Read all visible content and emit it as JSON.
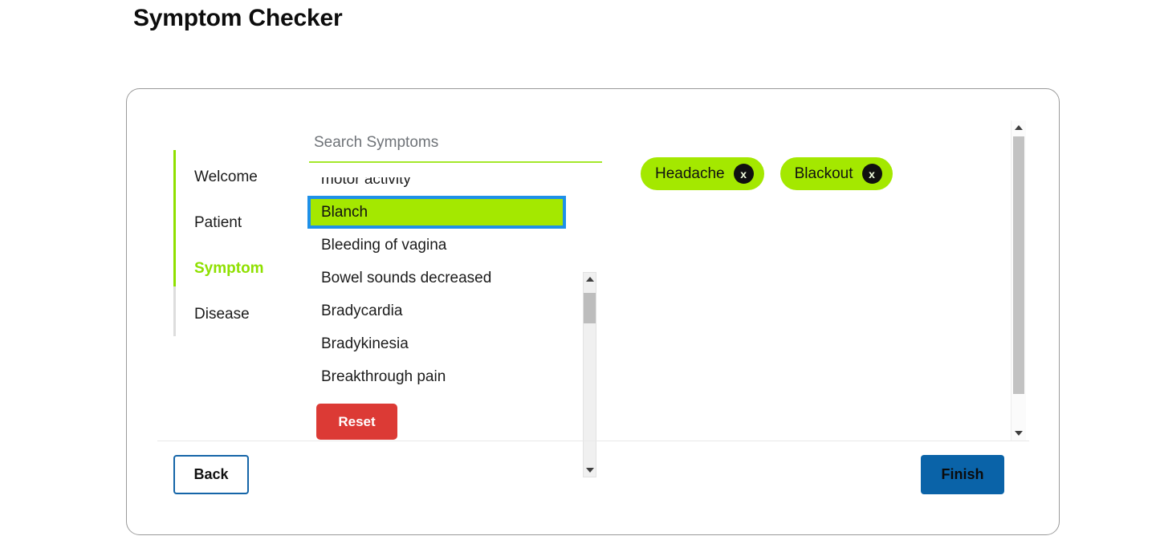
{
  "page": {
    "title": "Symptom Checker"
  },
  "stepper": {
    "steps": [
      {
        "label": "Welcome",
        "active": false
      },
      {
        "label": "Patient",
        "active": false
      },
      {
        "label": "Symptom",
        "active": true
      },
      {
        "label": "Disease",
        "active": false
      }
    ],
    "rail_color": "#8fe000",
    "rail_inactive_color": "#dddddd"
  },
  "search": {
    "placeholder": "Search Symptoms",
    "value": "",
    "underline_color": "#a4e82b"
  },
  "symptom_list": {
    "items": [
      {
        "label": "motor activity",
        "selected": false
      },
      {
        "label": "Blanch",
        "selected": true
      },
      {
        "label": "Bleeding of vagina",
        "selected": false
      },
      {
        "label": "Bowel sounds decreased",
        "selected": false
      },
      {
        "label": "Bradycardia",
        "selected": false
      },
      {
        "label": "Bradykinesia",
        "selected": false
      },
      {
        "label": "Breakthrough pain",
        "selected": false
      }
    ],
    "selected_bg": "#a4e800",
    "focus_outline": "#1e90e8",
    "scrollbar": {
      "up_arrow": "triangle-up-icon",
      "down_arrow": "triangle-down-icon",
      "thumb_color": "#bdbdbd",
      "track_color": "#f0f0f0"
    }
  },
  "selected_tags": {
    "items": [
      {
        "label": "Headache",
        "remove_label": "x"
      },
      {
        "label": "Blackout",
        "remove_label": "x"
      }
    ],
    "bg_color": "#a4e800",
    "remove_bg_color": "#101010"
  },
  "panel_scrollbar": {
    "up_arrow": "triangle-up-icon",
    "down_arrow": "triangle-down-icon",
    "thumb_color": "#c2c2c2",
    "track_color": "#fbfbfb"
  },
  "buttons": {
    "reset": {
      "label": "Reset",
      "bg": "#dc3a35",
      "fg": "#ffffff"
    },
    "back": {
      "label": "Back",
      "border": "#1565a8",
      "fg": "#111111"
    },
    "finish": {
      "label": "Finish",
      "bg": "#0a63a8",
      "fg": "#0b0b0b"
    }
  }
}
